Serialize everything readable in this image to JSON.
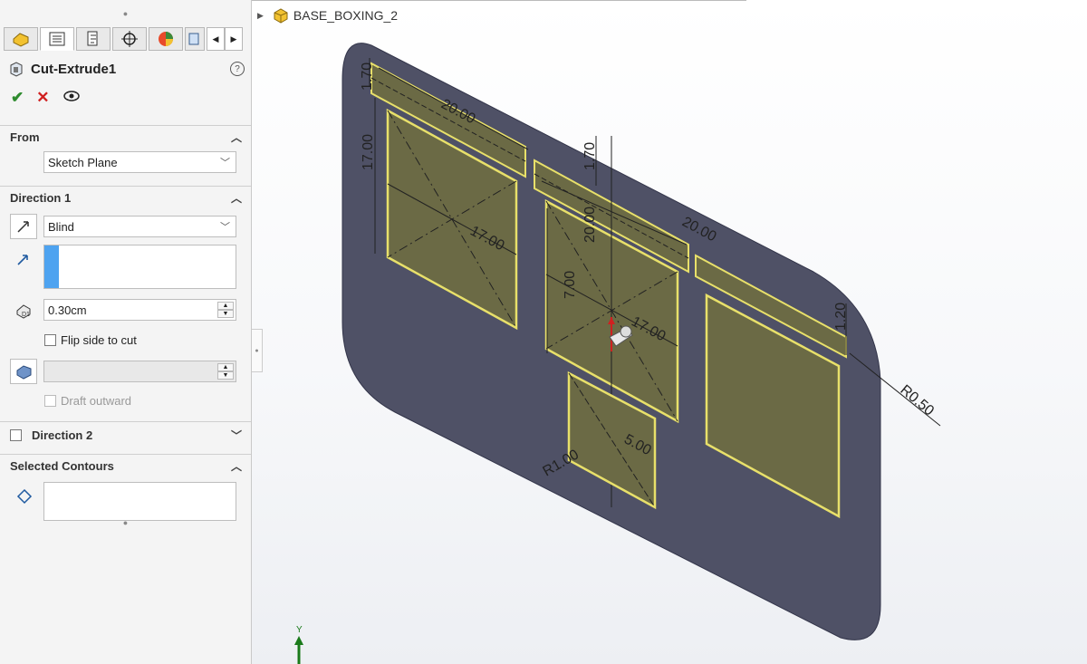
{
  "panel": {
    "feature_title": "Cut-Extrude1",
    "help_icon": "?",
    "sections": {
      "from": {
        "label": "From",
        "selected": "Sketch Plane"
      },
      "direction1": {
        "label": "Direction 1",
        "end_condition": "Blind",
        "depth_value": "0.30cm",
        "flip_side_label": "Flip side to cut",
        "draft_outward_label": "Draft outward"
      },
      "direction2": {
        "label": "Direction 2"
      },
      "selected_contours": {
        "label": "Selected Contours"
      }
    }
  },
  "tree": {
    "part_name": "BASE_BOXING_2"
  },
  "model": {
    "dimensions": {
      "d1": "1.70",
      "d2": "20.00",
      "d3": "17.00",
      "d4": "1.70",
      "d5": "17.00",
      "d6": "20.00",
      "d7": "7.00",
      "d8": "17.00",
      "d9": "R0.50",
      "d10": "1.20",
      "d11": "20.00",
      "d12": "R1.00",
      "d13": "5.00"
    },
    "axis_label": "Y"
  },
  "colors": {
    "plate": "#4f5166",
    "cutout_fill": "#6b6a45",
    "cutout_edge": "#e8e06a",
    "accept": "#2e8b2e",
    "cancel": "#d02020",
    "axis": "#1a7a1a"
  }
}
